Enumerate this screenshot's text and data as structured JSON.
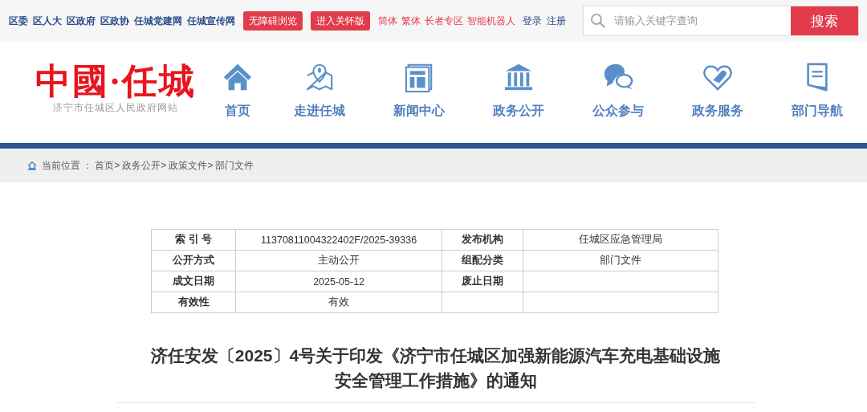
{
  "top_links": [
    "区委",
    "区人大",
    "区政府",
    "区政协",
    "任城党建网",
    "任城宣传网"
  ],
  "top_buttons": [
    "无障碍浏览",
    "进入关怀版"
  ],
  "lang_links": [
    "简体",
    "繁体",
    "长者专区",
    "智能机器人"
  ],
  "account_links": [
    "登录",
    "注册"
  ],
  "search": {
    "placeholder": "请输入关键字查询",
    "button": "搜索"
  },
  "logo": {
    "title": "中國·任城",
    "subtitle": "济宁市任城区人民政府网站"
  },
  "nav": [
    "首页",
    "走进任城",
    "新闻中心",
    "政务公开",
    "公众参与",
    "政务服务",
    "部门导航"
  ],
  "breadcrumb": {
    "label": "当前位置 ：",
    "items": [
      "首页>",
      "政务公开>",
      "政策文件>",
      "部门文件"
    ]
  },
  "info_table": [
    {
      "label_1": "索 引 号",
      "value_1": "11370811004322402F/2025-39336",
      "label_2": "发布机构",
      "value_2": "任城区应急管理局"
    },
    {
      "label_1": "公开方式",
      "value_1": "主动公开",
      "label_2": "组配分类",
      "value_2": "部门文件"
    },
    {
      "label_1": "成文日期",
      "value_1": "2025-05-12",
      "label_2": "废止日期"
    },
    {
      "label_1": "有效性",
      "value_1": "有效"
    }
  ],
  "title_lines": [
    "济任安发〔2025〕4号关于印发《济宁市任城区加强新能源汽车充电基础设施",
    "安全管理工作措施》的通知"
  ]
}
